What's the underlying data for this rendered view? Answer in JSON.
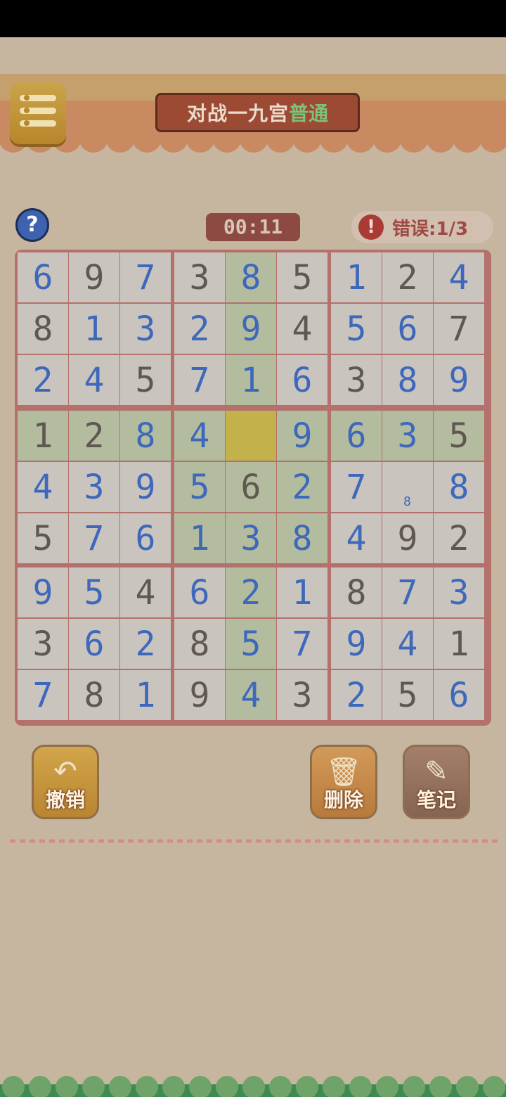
{
  "header": {
    "title_main": "对战一九宫",
    "title_mode": "普通",
    "menu_icon": "menu-list-icon"
  },
  "status": {
    "timer": "00:11",
    "errors_label": "错误:1/3",
    "error_icon": "!",
    "help_icon": "?"
  },
  "board": {
    "rows": [
      [
        "6",
        "9",
        "7",
        "3",
        "8",
        "5",
        "1",
        "2",
        "4"
      ],
      [
        "8",
        "1",
        "3",
        "2",
        "9",
        "4",
        "5",
        "6",
        "7"
      ],
      [
        "2",
        "4",
        "5",
        "7",
        "1",
        "6",
        "3",
        "8",
        "9"
      ],
      [
        "1",
        "2",
        "8",
        "4",
        "",
        "9",
        "6",
        "3",
        "5"
      ],
      [
        "4",
        "3",
        "9",
        "5",
        "6",
        "2",
        "7",
        "",
        "8"
      ],
      [
        "5",
        "7",
        "6",
        "1",
        "3",
        "8",
        "4",
        "9",
        "2"
      ],
      [
        "9",
        "5",
        "4",
        "6",
        "2",
        "1",
        "8",
        "7",
        "3"
      ],
      [
        "3",
        "6",
        "2",
        "8",
        "5",
        "7",
        "9",
        "4",
        "1"
      ],
      [
        "7",
        "8",
        "1",
        "9",
        "4",
        "3",
        "2",
        "5",
        "6"
      ]
    ],
    "kinds": [
      "bgbggbbbb",
      "gbbbbgbbg",
      "bbgbbbgbb",
      "gggb-bbbg",
      "bbbbgbb-b",
      "gbbbbbbgg",
      "bbgbbbgbb",
      "gbbgbbbbg",
      "bggggbgbgb"
    ],
    "note_cell": {
      "row": 4,
      "col": 7,
      "value": "8"
    }
  },
  "tools": {
    "undo_label": "撤销",
    "delete_label": "删除",
    "note_label": "笔记"
  },
  "colors": {
    "blue_digit": "#3e68bb",
    "given_digit": "#5f5850",
    "highlight": "#b3bc9e",
    "selected": "#c3b14b"
  }
}
